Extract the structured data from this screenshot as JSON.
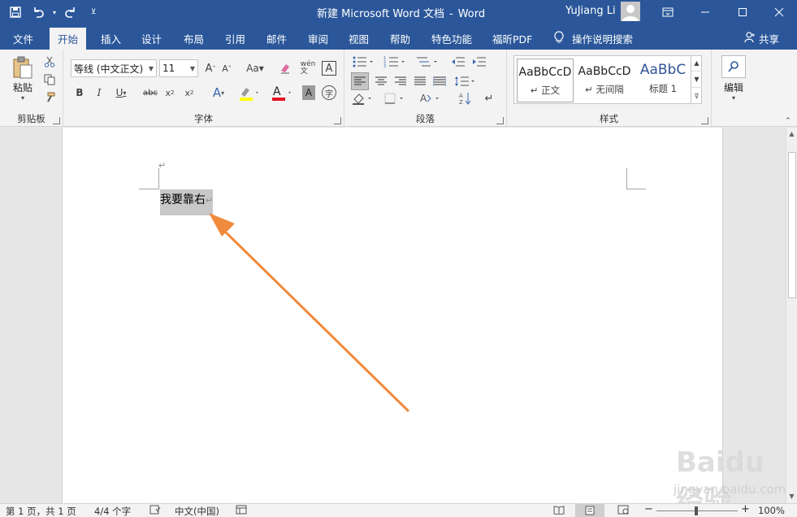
{
  "window": {
    "doc_name": "新建 Microsoft Word 文档",
    "separator": "-",
    "app_name": "Word",
    "user": "YuJiang Li"
  },
  "tabs": [
    {
      "label": "文件"
    },
    {
      "label": "开始"
    },
    {
      "label": "插入"
    },
    {
      "label": "设计"
    },
    {
      "label": "布局"
    },
    {
      "label": "引用"
    },
    {
      "label": "邮件"
    },
    {
      "label": "审阅"
    },
    {
      "label": "视图"
    },
    {
      "label": "帮助"
    },
    {
      "label": "特色功能"
    },
    {
      "label": "福昕PDF"
    }
  ],
  "tell_me": "操作说明搜索",
  "share_label": "共享",
  "ribbon": {
    "clipboard": {
      "label": "剪贴板",
      "paste": "粘贴"
    },
    "font": {
      "label": "字体",
      "font_name": "等线 (中文正文)",
      "font_size": "11"
    },
    "paragraph": {
      "label": "段落"
    },
    "styles": {
      "label": "样式",
      "items": [
        {
          "sample": "AaBbCcD",
          "name": "正文"
        },
        {
          "sample": "AaBbCcD",
          "name": "无间隔"
        },
        {
          "sample": "AaBbC",
          "name": "标题 1"
        }
      ]
    },
    "editing": {
      "label": "编辑"
    }
  },
  "document": {
    "text": "我要靠右",
    "para_mark": "↵"
  },
  "watermark": {
    "brand": "Baidu经验",
    "url": "jingyan.baidu.com"
  },
  "statusbar": {
    "page": "第 1 页，共 1 页",
    "words": "4/4 个字",
    "language": "中文(中国)",
    "zoom": "100%"
  },
  "colors": {
    "title_bar": "#2b579a",
    "ribbon_bg": "#f3f3f3",
    "selection": "#c8c8c8",
    "arrow": "#f08a3c",
    "font_color_bar": "#e81123",
    "highlight_bar": "#ffff00"
  }
}
